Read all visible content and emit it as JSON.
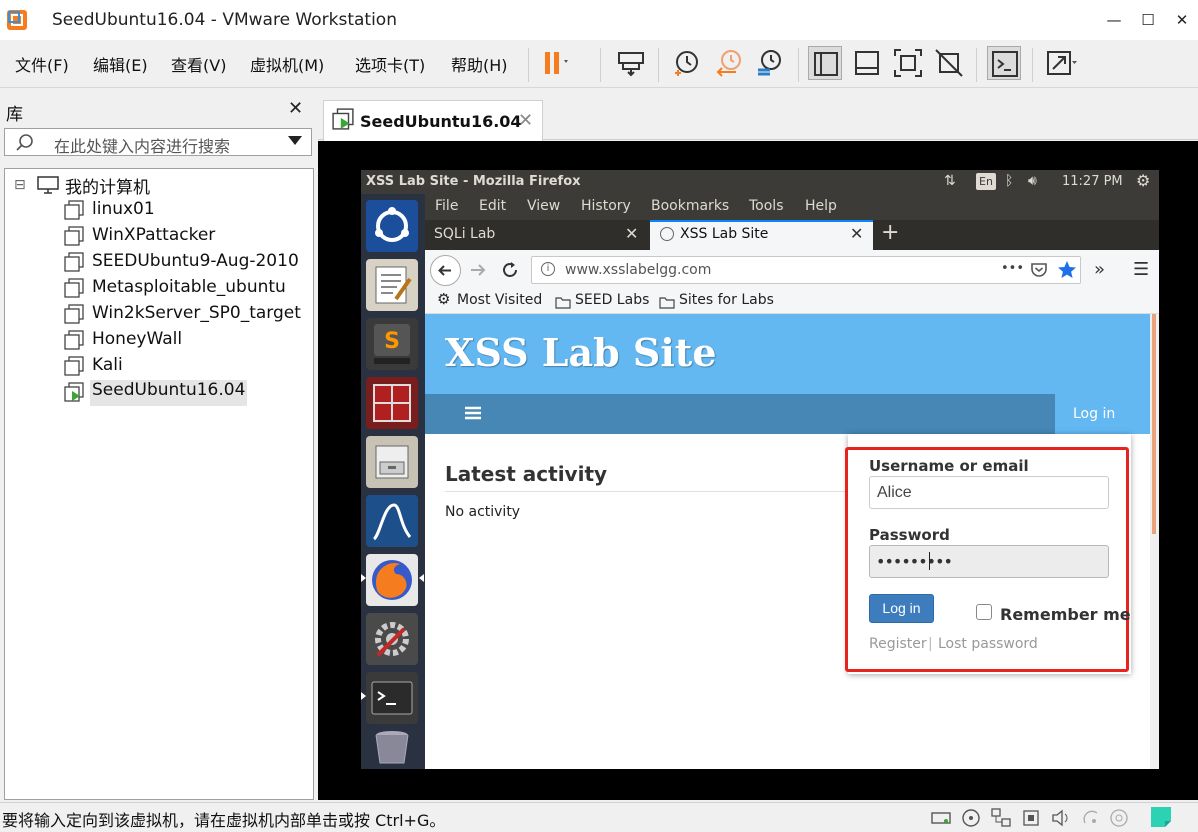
{
  "window": {
    "title": "SeedUbuntu16.04 - VMware Workstation",
    "minimize_glyph": "—",
    "maximize_glyph": "☐",
    "close_glyph": "✕"
  },
  "menu": {
    "items": [
      "文件(F)",
      "编辑(E)",
      "查看(V)",
      "虚拟机(M)",
      "选项卡(T)",
      "帮助(H)"
    ]
  },
  "toolbar": {
    "icons": [
      "pause-icon",
      "send-keys-icon",
      "snapshot-icon",
      "revert-snapshot-icon",
      "snapshot-manager-icon",
      "library-view-icon",
      "thumbnail-view-icon",
      "fullscreen-icon",
      "unity-icon",
      "console-icon",
      "stretch-icon"
    ],
    "accent_color": "#f57c1f"
  },
  "library": {
    "title": "库",
    "close_glyph": "✕",
    "search_placeholder": "在此处键入内容进行搜索",
    "root": "我的计算机",
    "root_toggle": "⊟",
    "items": [
      "linux01",
      "WinXPattacker",
      "SEEDUbuntu9-Aug-2010",
      "Metasploitable_ubuntu",
      "Win2kServer_SP0_target",
      "HoneyWall",
      "Kali",
      "SeedUbuntu16.04"
    ],
    "active_item": "SeedUbuntu16.04"
  },
  "vm_tab": {
    "label": "SeedUbuntu16.04",
    "close_glyph": "✕"
  },
  "guest": {
    "window_title": "XSS Lab Site - Mozilla Firefox",
    "time": "11:27 PM",
    "keyboard": "En",
    "firefox": {
      "menu": [
        "File",
        "Edit",
        "View",
        "History",
        "Bookmarks",
        "Tools",
        "Help"
      ],
      "tabs": [
        {
          "label": "SQLi Lab",
          "close": "✕"
        },
        {
          "label": "XSS Lab Site",
          "close": "✕"
        }
      ],
      "new_tab": "+",
      "url": "www.xsslabelgg.com",
      "url_more": "•••",
      "bookmarks": [
        "Most Visited",
        "SEED Labs",
        "Sites for Labs"
      ]
    },
    "page": {
      "site_title": "XSS Lab Site",
      "nav_login": "Log in",
      "activity_title": "Latest activity",
      "activity_empty": "No activity",
      "login": {
        "username_label": "Username or email",
        "username_value": "Alice",
        "password_label": "Password",
        "password_value": "•••••••••",
        "submit": "Log in",
        "remember": "Remember me",
        "register": "Register",
        "separator": "|",
        "lost_password": "Lost password"
      },
      "highlight_color": "#e8231f",
      "header_color": "#63b8f2",
      "nav_color": "#4687b6"
    }
  },
  "status": {
    "text": "要将输入定向到该虚拟机，请在虚拟机内部单击或按 Ctrl+G。"
  }
}
